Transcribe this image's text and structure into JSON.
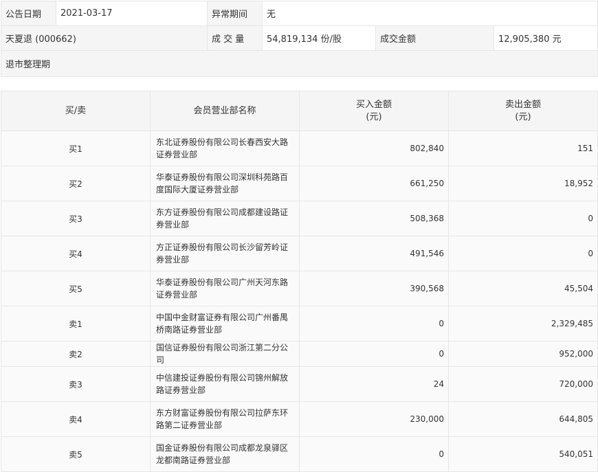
{
  "summary": {
    "date_label": "公告日期",
    "date_value": "2021-03-17",
    "period_label": "异常期间",
    "period_value": "无",
    "stock": "天夏退 (000662)",
    "volume_label": "成 交 量",
    "volume_value": "54,819,134 份/股",
    "amount_label": "成交金额",
    "amount_value": "12,905,380 元",
    "reason": "退市整理期"
  },
  "table": {
    "headers": {
      "side": "买/卖",
      "branch": "会员营业部名称",
      "buy": "买入金额",
      "buy_unit": "(元)",
      "sell": "卖出金额",
      "sell_unit": "(元)"
    },
    "rows": [
      {
        "side": "买1",
        "branch": "东北证券股份有限公司长春西安大路证券营业部",
        "buy": "802,840",
        "sell": "151"
      },
      {
        "side": "买2",
        "branch": "华泰证券股份有限公司深圳科苑路百度国际大厦证券营业部",
        "buy": "661,250",
        "sell": "18,952"
      },
      {
        "side": "买3",
        "branch": "东方证券股份有限公司成都建设路证券营业部",
        "buy": "508,368",
        "sell": "0"
      },
      {
        "side": "买4",
        "branch": "方正证券股份有限公司长沙留芳岭证券营业部",
        "buy": "491,546",
        "sell": "0"
      },
      {
        "side": "买5",
        "branch": "华泰证券股份有限公司广州天河东路证券营业部",
        "buy": "390,568",
        "sell": "45,504"
      },
      {
        "side": "卖1",
        "branch": "中国中金财富证券有限公司广州番禺桥南路证券营业部",
        "buy": "0",
        "sell": "2,329,485"
      },
      {
        "side": "卖2",
        "branch": "国信证券股份有限公司浙江第二分公司",
        "buy": "0",
        "sell": "952,000"
      },
      {
        "side": "卖3",
        "branch": "中信建投证券股份有限公司锦州解放路证券营业部",
        "buy": "24",
        "sell": "720,000"
      },
      {
        "side": "卖4",
        "branch": "东方财富证券股份有限公司拉萨东环路第二证券营业部",
        "buy": "230,000",
        "sell": "644,805"
      },
      {
        "side": "卖5",
        "branch": "国金证券股份有限公司成都龙泉驿区龙都南路证券营业部",
        "buy": "0",
        "sell": "540,051"
      }
    ]
  }
}
